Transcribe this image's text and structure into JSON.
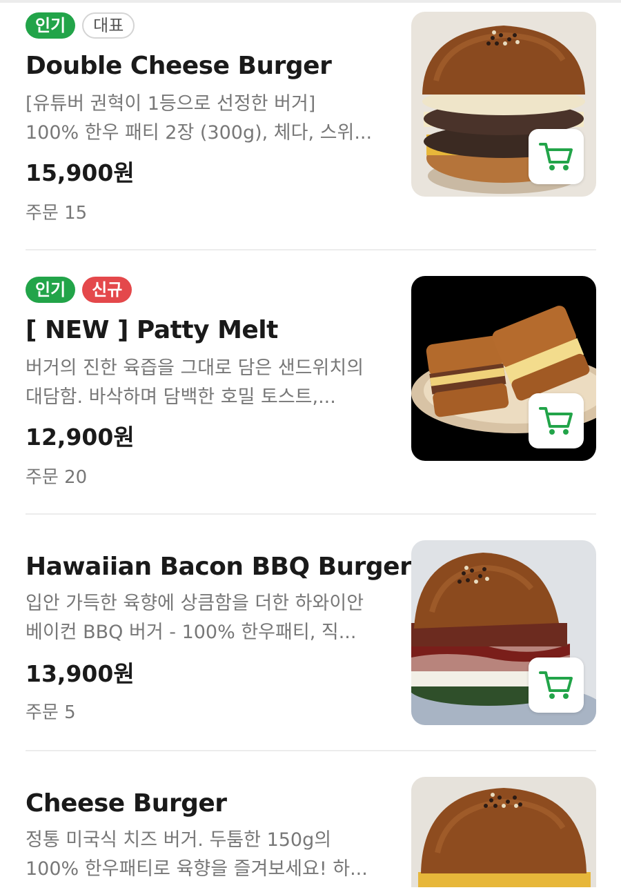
{
  "colors": {
    "accent_green": "#22a449",
    "badge_new_red": "#e4484b",
    "price_text": "#1a1a1a",
    "muted_text": "#777777"
  },
  "menu": {
    "items": [
      {
        "badges": [
          "인기",
          "대표"
        ],
        "name": "Double Cheese Burger",
        "desc_line1": "[유튜버 권혁이 1등으로 선정한 버거]",
        "desc_line2": "100% 한우 패티 2장 (300g), 체다, 스위...",
        "price": "15,900원",
        "orders": "주문 15",
        "image": "double-cheese-burger-photo",
        "cart_icon": "cart-icon"
      },
      {
        "badges": [
          "인기",
          "신규"
        ],
        "name": "[ NEW ] Patty Melt",
        "desc_line1": "버거의 진한 육즙을 그대로 담은 샌드위치의",
        "desc_line2": "대담함. 바삭하며 담백한 호밀 토스트,...",
        "price": "12,900원",
        "orders": "주문 20",
        "image": "patty-melt-photo",
        "cart_icon": "cart-icon"
      },
      {
        "badges": [],
        "name": "Hawaiian Bacon BBQ Burger",
        "desc_line1": "입안 가득한 육향에 상큼함을 더한 하와이안",
        "desc_line2": "베이컨 BBQ 버거 - 100% 한우패티, 직...",
        "price": "13,900원",
        "orders": "주문 5",
        "image": "hawaiian-bbq-burger-photo",
        "cart_icon": "cart-icon"
      },
      {
        "badges": [],
        "name": "Cheese Burger",
        "desc_line1": "정통 미국식 치즈 버거. 두툼한 150g의",
        "desc_line2": "100% 한우패티로 육향을 즐겨보세요! 하...",
        "image": "cheese-burger-photo"
      }
    ]
  }
}
